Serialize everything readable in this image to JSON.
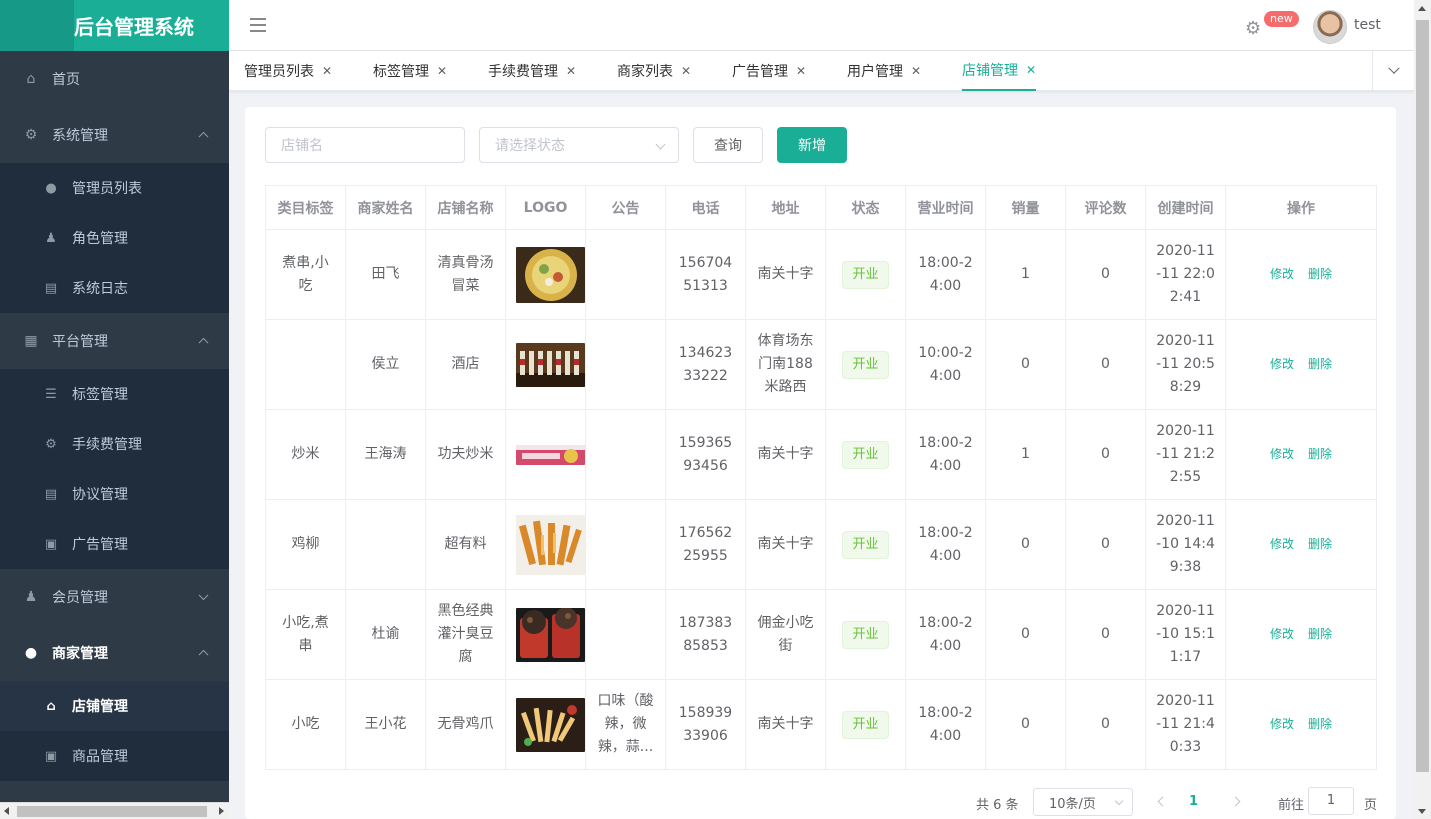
{
  "app": {
    "title": "后台管理系统"
  },
  "header": {
    "new_badge": "new",
    "username": "test"
  },
  "sidebar": {
    "home": "首页",
    "groups": [
      {
        "label": "系统管理",
        "icon": "gear-icon",
        "items": [
          "管理员列表",
          "角色管理",
          "系统日志"
        ]
      },
      {
        "label": "平台管理",
        "icon": "grid-icon",
        "items": [
          "标签管理",
          "手续费管理",
          "协议管理",
          "广告管理"
        ]
      },
      {
        "label": "会员管理",
        "icon": "member-icon"
      },
      {
        "label": "商家管理",
        "icon": "user-icon",
        "items": [
          "店铺管理",
          "商品管理"
        ]
      }
    ]
  },
  "tabs": [
    "管理员列表",
    "标签管理",
    "手续费管理",
    "商家列表",
    "广告管理",
    "用户管理",
    "店铺管理"
  ],
  "filters": {
    "shop_name_placeholder": "店铺名",
    "status_placeholder": "请选择状态",
    "query_label": "查询",
    "add_label": "新增"
  },
  "table": {
    "headers": [
      "类目标签",
      "商家姓名",
      "店铺名称",
      "LOGO",
      "公告",
      "电话",
      "地址",
      "状态",
      "营业时间",
      "销量",
      "评论数",
      "创建时间",
      "操作"
    ],
    "rows": [
      {
        "tags": "煮串,小吃",
        "owner": "田飞",
        "shop": "清真骨汤冒菜",
        "notice": "",
        "phone": "15670451313",
        "address": "南关十字",
        "status": "开业",
        "hours": "18:00-24:00",
        "sales": "1",
        "comments": "0",
        "created": "2020-11-11 22:02:41",
        "logo": "soup"
      },
      {
        "tags": "",
        "owner": "侯立",
        "shop": "酒店",
        "notice": "",
        "phone": "13462333222",
        "address": "体育场东门南188米路西",
        "status": "开业",
        "hours": "10:00-24:00",
        "sales": "0",
        "comments": "0",
        "created": "2020-11-11 20:58:29",
        "logo": "bottles"
      },
      {
        "tags": "炒米",
        "owner": "王海涛",
        "shop": "功夫炒米",
        "notice": "",
        "phone": "15936593456",
        "address": "南关十字",
        "status": "开业",
        "hours": "18:00-24:00",
        "sales": "1",
        "comments": "0",
        "created": "2020-11-11 21:22:55",
        "logo": "banner"
      },
      {
        "tags": "鸡柳",
        "owner": "",
        "shop": "超有料",
        "notice": "",
        "phone": "17656225955",
        "address": "南关十字",
        "status": "开业",
        "hours": "18:00-24:00",
        "sales": "0",
        "comments": "0",
        "created": "2020-11-10 14:49:38",
        "logo": "fries"
      },
      {
        "tags": "小吃,煮串",
        "owner": "杜谕",
        "shop": "黑色经典灌汁臭豆腐",
        "notice": "",
        "phone": "18738385853",
        "address": "佣金小吃街",
        "status": "开业",
        "hours": "18:00-24:00",
        "sales": "0",
        "comments": "0",
        "created": "2020-11-10 15:11:17",
        "logo": "tofu"
      },
      {
        "tags": "小吃",
        "owner": "王小花",
        "shop": "无骨鸡爪",
        "notice": "口味（酸辣，微辣，蒜...",
        "phone": "15893933906",
        "address": "南关十字",
        "status": "开业",
        "hours": "18:00-24:00",
        "sales": "0",
        "comments": "0",
        "created": "2020-11-11 21:40:33",
        "logo": "chicken"
      }
    ],
    "edit_label": "修改",
    "delete_label": "删除"
  },
  "pagination": {
    "total": "共 6 条",
    "page_size": "10条/页",
    "current": "1",
    "goto_prefix": "前往",
    "goto_value": "1",
    "goto_suffix": "页"
  },
  "colors": {
    "accent": "#1aae97",
    "sidebar_bg": "#2e3a46",
    "submenu_bg": "#1f2d3d",
    "status_open": "#67c23a"
  }
}
